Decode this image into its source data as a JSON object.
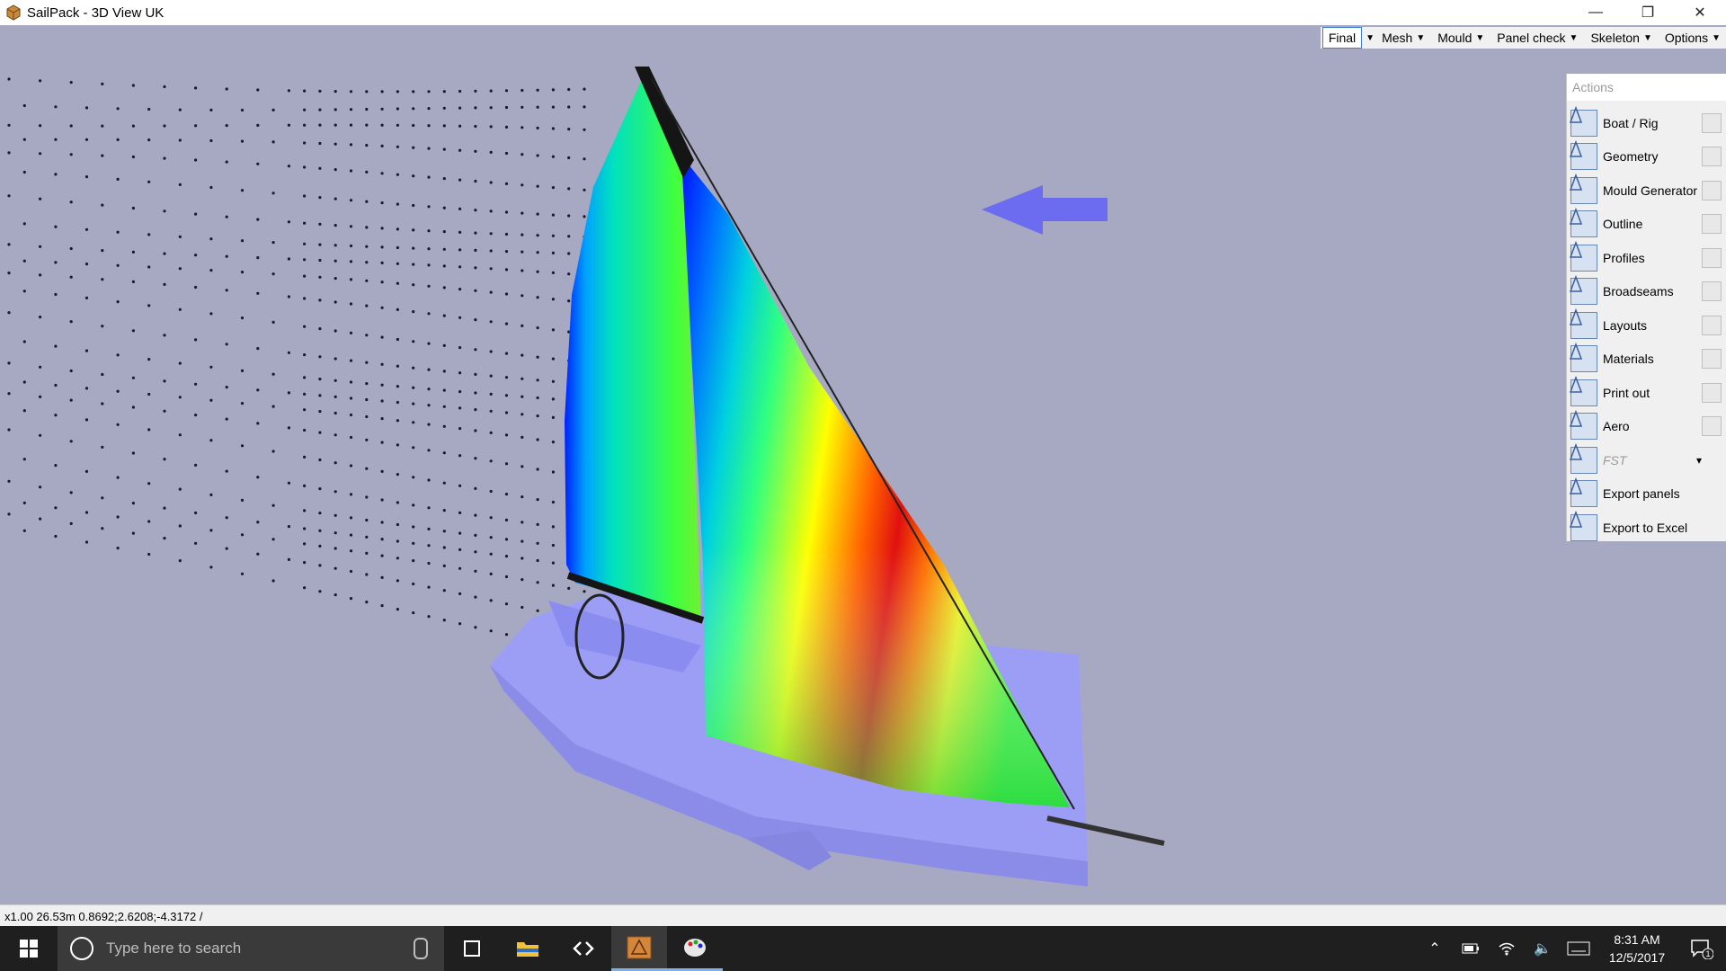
{
  "window": {
    "title": "SailPack - 3D View  UK"
  },
  "toolbar": {
    "items": [
      {
        "label": "Final",
        "active": true
      },
      {
        "label": "Mesh"
      },
      {
        "label": "Mould"
      },
      {
        "label": "Panel check"
      },
      {
        "label": "Skeleton"
      },
      {
        "label": "Options"
      }
    ]
  },
  "actions": {
    "title": "Actions",
    "items": [
      {
        "label": "Boat / Rig",
        "icon": "boat-rig-icon"
      },
      {
        "label": "Geometry",
        "icon": "geometry-icon"
      },
      {
        "label": "Mould Generator",
        "icon": "mould-generator-icon"
      },
      {
        "label": "Outline",
        "icon": "outline-icon"
      },
      {
        "label": "Profiles",
        "icon": "profiles-icon"
      },
      {
        "label": "Broadseams",
        "icon": "broadseams-icon"
      },
      {
        "label": "Layouts",
        "icon": "layouts-icon"
      },
      {
        "label": "Materials",
        "icon": "materials-icon"
      },
      {
        "label": "Print out",
        "icon": "print-out-icon"
      },
      {
        "label": "Aero",
        "icon": "aero-icon"
      },
      {
        "label": "FST",
        "icon": "fst-icon"
      },
      {
        "label": "Export panels",
        "icon": "export-panels-icon"
      },
      {
        "label": "Export to Excel",
        "icon": "excel-icon"
      }
    ]
  },
  "status": {
    "text": "x1.00  26.53m  0.8692;2.6208;-4.3172 /"
  },
  "taskbar": {
    "search_placeholder": "Type here to search",
    "time": "8:31 AM",
    "date": "12/5/2017",
    "notification_count": "1"
  },
  "colors": {
    "viewport_bg": "#a7a9c2",
    "hull": "#9c9ef5",
    "wind_arrow": "#6c6cf0",
    "accent": "#3c7fd2"
  }
}
